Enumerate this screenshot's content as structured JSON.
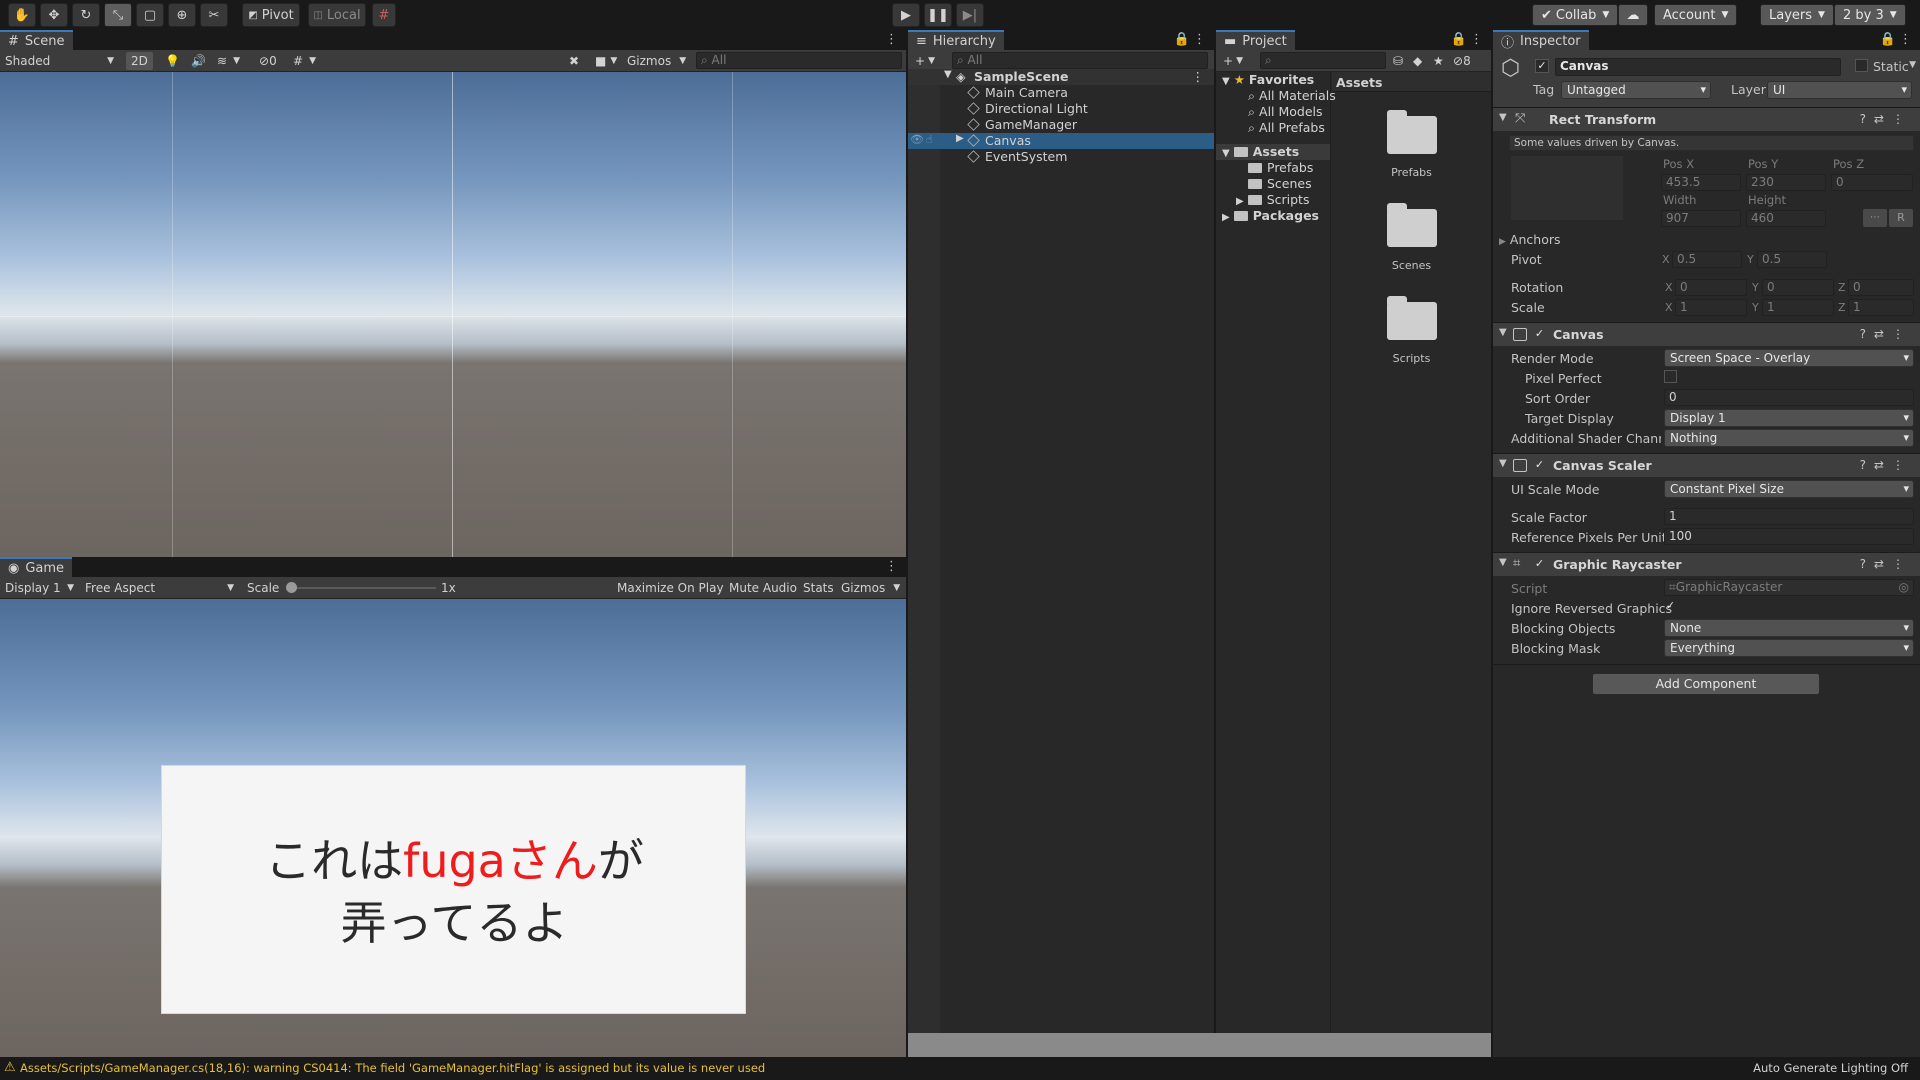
{
  "toolbar": {
    "tools": [
      "hand-tool-icon",
      "move-tool-icon",
      "rotate-tool-icon",
      "scale-tool-icon",
      "rect-tool-icon",
      "transform-tool-icon",
      "custom-tool-icon"
    ],
    "pivot_label": "Pivot",
    "local_label": "Local",
    "collab_label": "Collab",
    "account_label": "Account",
    "layers_label": "Layers",
    "layout_label": "2 by 3"
  },
  "scene": {
    "tab_label": "Scene",
    "shading_mode": "Shaded",
    "mode_2d": "2D",
    "hidden_count": "0",
    "gizmos_label": "Gizmos",
    "search_placeholder": "All"
  },
  "game": {
    "tab_label": "Game",
    "display": "Display 1",
    "aspect": "Free Aspect",
    "scale_label": "Scale",
    "scale_value": "1x",
    "scale_fraction": 0.0,
    "maximize_label": "Maximize On Play",
    "mute_label": "Mute Audio",
    "stats_label": "Stats",
    "gizmos_label": "Gizmos",
    "dialog": {
      "line1_pre": "これは",
      "line1_highlight": "fugaさん",
      "line1_post": "が",
      "line2": "弄ってるよ",
      "highlight_color": "#ee1c1c",
      "text_color": "#2a2a2a"
    }
  },
  "hierarchy": {
    "tab_label": "Hierarchy",
    "search_placeholder": "All",
    "scene_name": "SampleScene",
    "items": [
      {
        "label": "Main Camera"
      },
      {
        "label": "Directional Light"
      },
      {
        "label": "GameManager"
      },
      {
        "label": "Canvas",
        "selected": true
      },
      {
        "label": "EventSystem"
      }
    ]
  },
  "project": {
    "tab_label": "Project",
    "hidden_count": "8",
    "tree": {
      "favorites": "Favorites",
      "fav_items": [
        "All Materials",
        "All Models",
        "All Prefabs"
      ],
      "assets": "Assets",
      "asset_items": [
        "Prefabs",
        "Scenes",
        "Scripts"
      ],
      "packages": "Packages"
    },
    "breadcrumb": "Assets",
    "folders": [
      "Prefabs",
      "Scenes",
      "Scripts"
    ]
  },
  "inspector": {
    "tab_label": "Inspector",
    "object_name": "Canvas",
    "static_label": "Static",
    "tag_label": "Tag",
    "tag_value": "Untagged",
    "layer_label": "Layer",
    "layer_value": "UI",
    "rect_transform": {
      "title": "Rect Transform",
      "note": "Some values driven by Canvas.",
      "pos_x_label": "Pos X",
      "pos_x": "453.5",
      "pos_y_label": "Pos Y",
      "pos_y": "230",
      "pos_z_label": "Pos Z",
      "pos_z": "0",
      "width_label": "Width",
      "width": "907",
      "height_label": "Height",
      "height": "460",
      "r_button": "R",
      "anchors_label": "Anchors",
      "pivot_label": "Pivot",
      "pivot_x": "0.5",
      "pivot_y": "0.5",
      "rotation_label": "Rotation",
      "rot_x": "0",
      "rot_y": "0",
      "rot_z": "0",
      "scale_label": "Scale",
      "scale_x": "1",
      "scale_y": "1",
      "scale_z": "1",
      "x": "X",
      "y": "Y",
      "z": "Z"
    },
    "canvas": {
      "title": "Canvas",
      "render_mode_label": "Render Mode",
      "render_mode": "Screen Space - Overlay",
      "pixel_perfect_label": "Pixel Perfect",
      "sort_order_label": "Sort Order",
      "sort_order": "0",
      "target_display_label": "Target Display",
      "target_display": "Display 1",
      "shader_channels_label": "Additional Shader Channels",
      "shader_channels": "Nothing"
    },
    "canvas_scaler": {
      "title": "Canvas Scaler",
      "ui_scale_mode_label": "UI Scale Mode",
      "ui_scale_mode": "Constant Pixel Size",
      "scale_factor_label": "Scale Factor",
      "scale_factor": "1",
      "ref_ppu_label": "Reference Pixels Per Unit",
      "ref_ppu": "100"
    },
    "graphic_raycaster": {
      "title": "Graphic Raycaster",
      "script_label": "Script",
      "script": "GraphicRaycaster",
      "ignore_reversed_label": "Ignore Reversed Graphics",
      "blocking_objects_label": "Blocking Objects",
      "blocking_objects": "None",
      "blocking_mask_label": "Blocking Mask",
      "blocking_mask": "Everything"
    },
    "add_component": "Add Component"
  },
  "status_bar": {
    "warning": "Assets/Scripts/GameManager.cs(18,16): warning CS0414: The field 'GameManager.hitFlag' is assigned but its value is never used",
    "lighting": "Auto Generate Lighting Off"
  }
}
